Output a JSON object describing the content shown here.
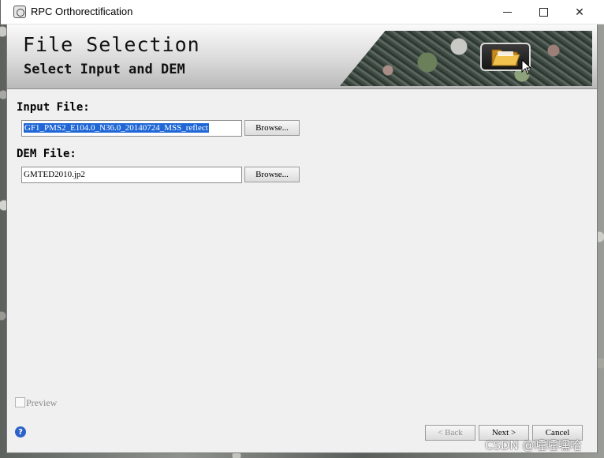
{
  "window": {
    "title": "RPC Orthorectification",
    "controls": {
      "minimize": "minimize",
      "maximize": "maximize",
      "close": "✕"
    }
  },
  "banner": {
    "title": "File Selection",
    "subtitle": "Select Input and DEM"
  },
  "input_file": {
    "label": "Input File:",
    "value": "GF1_PMS2_E104.0_N36.0_20140724_MSS_reflect",
    "browse_label": "Browse..."
  },
  "dem_file": {
    "label": "DEM File:",
    "value": "GMTED2010.jp2",
    "browse_label": "Browse..."
  },
  "preview": {
    "label": "Preview",
    "checked": false
  },
  "footer": {
    "help": "?",
    "back_label": "< Back",
    "next_label": "Next >",
    "cancel_label": "Cancel"
  },
  "watermark": "CSDN @嚯嚯嘿哈",
  "colors": {
    "selection": "#1f67d6",
    "help_icon": "#2c62c8",
    "window_bg": "#f0f0f0"
  }
}
